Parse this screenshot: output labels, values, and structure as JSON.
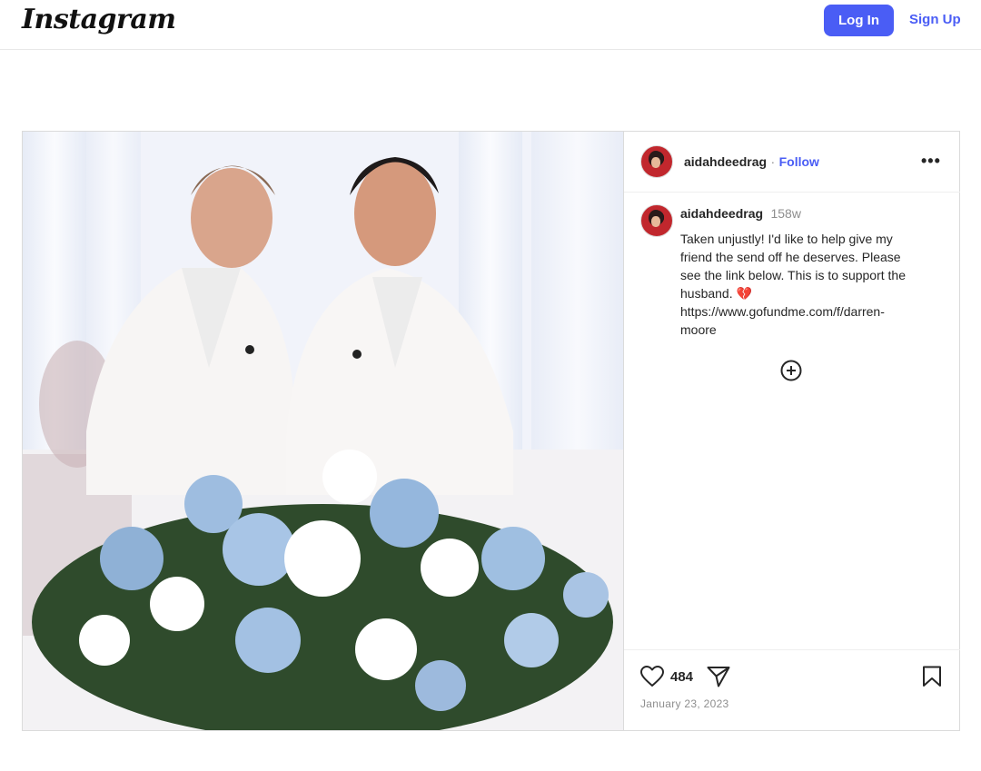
{
  "brand": {
    "logo": "Instagram"
  },
  "nav": {
    "login_label": "Log In",
    "signup_label": "Sign Up",
    "accent": "#4a5df5"
  },
  "post": {
    "author": "aidahdeedrag",
    "follow_separator": "·",
    "follow_label": "Follow",
    "more_label": "•••",
    "caption": {
      "username": "aidahdeedrag",
      "age": "158w",
      "lines": [
        "Taken unjustly! I'd like to help give my",
        "friend the send off he deserves. Please",
        "see the link below. This is to support the",
        "husband. 💔",
        "https://www.gofundme.com/f/darren-",
        "moore"
      ]
    },
    "likes": "484",
    "date": "January 23, 2023",
    "icons": {
      "like": "heart-icon",
      "share": "send-icon",
      "save": "bookmark-icon",
      "expand": "plus-circle-icon",
      "more": "more-icon"
    }
  }
}
